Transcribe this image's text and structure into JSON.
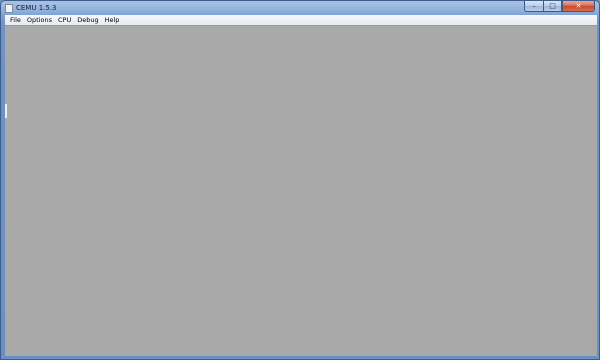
{
  "window": {
    "title": "CEMU 1.5.3",
    "icon": "app-window-icon",
    "controls": {
      "minimize_glyph": "–",
      "maximize_glyph": "□",
      "close_glyph": "✕"
    }
  },
  "menubar": {
    "items": [
      {
        "label": "File"
      },
      {
        "label": "Options"
      },
      {
        "label": "CPU"
      },
      {
        "label": "Debug"
      },
      {
        "label": "Help"
      }
    ]
  },
  "client_area": {
    "background": "#a9a9a9"
  }
}
